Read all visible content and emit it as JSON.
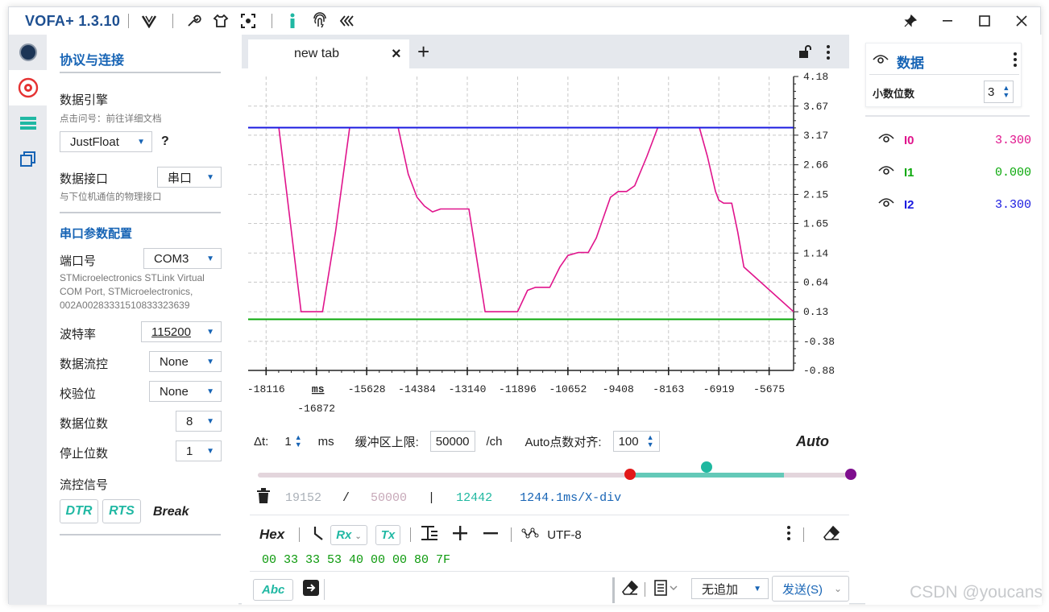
{
  "title": {
    "app": "VOFA+ 1.3.10"
  },
  "left_panel": {
    "header": "协议与连接",
    "engine_label": "数据引擎",
    "engine_hint": "点击问号：前往详细文档",
    "engine_value": "JustFloat",
    "help": "?",
    "interface_label": "数据接口",
    "interface_value": "串口",
    "interface_hint": "与下位机通信的物理接口",
    "serial_header": "串口参数配置",
    "port_label": "端口号",
    "port_value": "COM3",
    "port_desc": "STMicroelectronics STLink Virtual COM Port, STMicroelectronics, 002A00283331510833323639",
    "baud_label": "波特率",
    "baud_value": "115200",
    "flow_label": "数据流控",
    "flow_value": "None",
    "parity_label": "校验位",
    "parity_value": "None",
    "databits_label": "数据位数",
    "databits_value": "8",
    "stopbits_label": "停止位数",
    "stopbits_value": "1",
    "signal_label": "流控信号",
    "dtr": "DTR",
    "rts": "RTS",
    "break": "Break"
  },
  "tab": {
    "label": "new tab",
    "close": "×",
    "add": "+"
  },
  "chart_data": {
    "type": "line",
    "xlabel": "ms",
    "x_ticks": [
      "-18116",
      "-16872",
      "-15628",
      "-14384",
      "-13140",
      "-11896",
      "-10652",
      "-9408",
      "-8163",
      "-6919",
      "-5675"
    ],
    "y_ticks": [
      "4.18",
      "3.67",
      "3.17",
      "2.66",
      "2.15",
      "1.65",
      "1.14",
      "0.64",
      "0.13",
      "-0.38",
      "-0.88"
    ],
    "xlim": [
      -18560,
      -5070
    ],
    "ylim": [
      -0.88,
      4.18
    ],
    "grid": true,
    "series": [
      {
        "name": "I0",
        "color": "#e0148c",
        "x": [
          -18560,
          -17970,
          -17800,
          -17250,
          -17150,
          -17100,
          -16900,
          -16720,
          -16400,
          -16050,
          -15720,
          -15550,
          -15350,
          -15150,
          -14850,
          -14600,
          -14384,
          -14200,
          -14000,
          -13800,
          -13500,
          -13100,
          -12700,
          -12500,
          -12200,
          -11950,
          -11896,
          -11650,
          -11450,
          -11250,
          -11100,
          -10850,
          -10652,
          -10400,
          -10150,
          -9950,
          -9750,
          -9600,
          -9408,
          -9200,
          -9000,
          -8700,
          -8430,
          -8300,
          -8163,
          -8000,
          -7850,
          -7650,
          -7400,
          -7200,
          -7000,
          -6919,
          -6800,
          -6700,
          -6600,
          -6450,
          -6300,
          -5070
        ],
        "y": [
          3.3,
          3.3,
          3.3,
          0.13,
          0.13,
          0.13,
          0.13,
          0.13,
          1.5,
          3.3,
          3.3,
          3.3,
          3.3,
          3.3,
          3.3,
          2.5,
          2.1,
          1.95,
          1.85,
          1.9,
          1.9,
          1.9,
          0.13,
          0.13,
          0.13,
          0.13,
          0.13,
          0.5,
          0.55,
          0.55,
          0.55,
          0.9,
          1.1,
          1.15,
          1.15,
          1.4,
          1.8,
          2.1,
          2.2,
          2.2,
          2.3,
          2.8,
          3.3,
          3.3,
          3.3,
          3.3,
          3.3,
          3.3,
          3.3,
          2.8,
          2.2,
          2.05,
          2.0,
          2.0,
          2.0,
          1.5,
          0.9,
          0.13
        ]
      },
      {
        "name": "I1",
        "color": "#0aa80a",
        "x": [
          -18560,
          -5070
        ],
        "y": [
          0.0,
          0.0
        ]
      },
      {
        "name": "I2",
        "color": "#1a1ae0",
        "x": [
          -18560,
          -5070
        ],
        "y": [
          3.3,
          3.3
        ]
      }
    ]
  },
  "controls": {
    "dt_label": "Δt:",
    "dt_value": "1",
    "dt_unit": "ms",
    "buffer_label": "缓冲区上限:",
    "buffer_value": "50000",
    "buffer_unit": "/ch",
    "align_label": "Auto点数对齐:",
    "align_value": "100",
    "auto": "Auto"
  },
  "stats": {
    "count": "19152",
    "slash": "/",
    "limit": "50000",
    "bar": "|",
    "pos": "12442",
    "div": "1244.1ms/X-div"
  },
  "terminal": {
    "hex": "Hex",
    "rx": "Rx",
    "tx": "Tx",
    "encoding": "UTF-8",
    "data": "00 33 33 53 40 00 00 80 7F",
    "abc": "Abc",
    "append": "无追加",
    "send": "发送(S)"
  },
  "right_panel": {
    "header": "数据",
    "decimals_label": "小数位数",
    "decimals_value": "3",
    "channels": [
      {
        "name": "I0",
        "value": "3.300",
        "color": "#e0148c"
      },
      {
        "name": "I1",
        "value": "0.000",
        "color": "#0aa80a"
      },
      {
        "name": "I2",
        "value": "3.300",
        "color": "#1a1ae0"
      }
    ]
  },
  "watermark": "CSDN @youcans"
}
